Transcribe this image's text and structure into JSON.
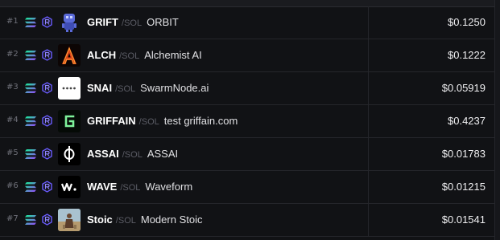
{
  "rows": [
    {
      "rank": "#1",
      "symbol": "GRIFT",
      "quote": "SOL",
      "name": "ORBIT",
      "price": "$0.1250",
      "avatar": "orbit-robot"
    },
    {
      "rank": "#2",
      "symbol": "ALCH",
      "quote": "SOL",
      "name": "Alchemist AI",
      "price": "$0.1222",
      "avatar": "alchemist-a"
    },
    {
      "rank": "#3",
      "symbol": "SNAI",
      "quote": "SOL",
      "name": "SwarmNode.ai",
      "price": "$0.05919",
      "avatar": "swarmnode"
    },
    {
      "rank": "#4",
      "symbol": "GRIFFAIN",
      "quote": "SOL",
      "name": "test griffain.com",
      "price": "$0.4237",
      "avatar": "griffain-g"
    },
    {
      "rank": "#5",
      "symbol": "ASSAI",
      "quote": "SOL",
      "name": "ASSAI",
      "price": "$0.01783",
      "avatar": "assai-phi"
    },
    {
      "rank": "#6",
      "symbol": "WAVE",
      "quote": "SOL",
      "name": "Waveform",
      "price": "$0.01215",
      "avatar": "waveform-w"
    },
    {
      "rank": "#7",
      "symbol": "Stoic",
      "quote": "SOL",
      "name": "Modern Stoic",
      "price": "$0.01541",
      "avatar": "stoic-figure"
    }
  ],
  "colors": {
    "solana_gradient": [
      "#14f195",
      "#9945ff"
    ],
    "raydium": "#6a5cff",
    "background": "#111215"
  },
  "icons": {
    "chain": "solana-icon",
    "dex": "raydium-icon"
  },
  "separator": "/"
}
